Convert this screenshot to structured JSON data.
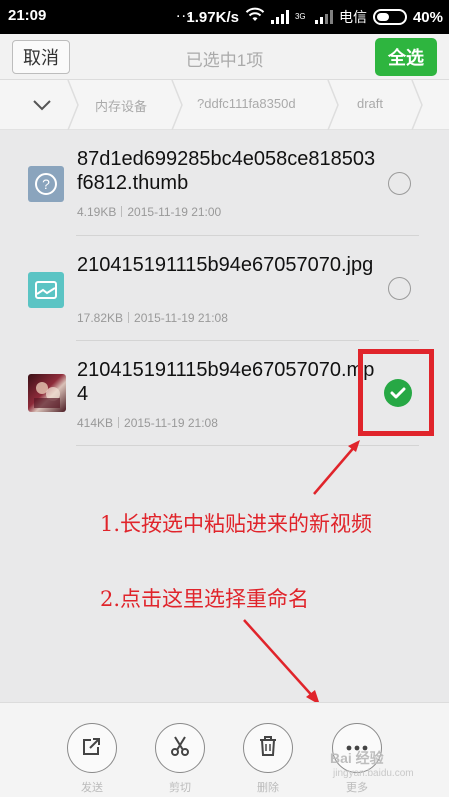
{
  "status_bar": {
    "time": "21:09",
    "dots": "...",
    "speed": "1.97K/s",
    "network_type": "3G",
    "carrier": "电信",
    "battery": "40%"
  },
  "title_bar": {
    "cancel_label": "取消",
    "title": "已选中1项",
    "select_all_label": "全选",
    "accent_color": "#2eb53f"
  },
  "breadcrumb": {
    "items": [
      "内存设备",
      "?ddfc111fa8350d",
      "draft"
    ]
  },
  "files": [
    {
      "name": "87d1ed699285bc4e058ce818503f6812.thumb",
      "size": "4.19KB",
      "date": "2015-11-19 21:00",
      "icon": "unknown-file-icon",
      "icon_color": "#8aa4bd",
      "selected": false
    },
    {
      "name": "210415191115b94e67057070.jpg",
      "size": "17.82KB",
      "date": "2015-11-19 21:08",
      "icon": "image-file-icon",
      "icon_color": "#5bc4c4",
      "selected": false
    },
    {
      "name": "210415191115b94e67057070.mp4",
      "size": "414KB",
      "date": "2015-11-19 21:08",
      "icon": "video-thumbnail",
      "icon_color": "#6a1f2a",
      "selected": true
    }
  ],
  "annotations": {
    "step1": "1.长按选中粘贴进来的新视频",
    "step2": "2.点击这里选择重命名",
    "color": "#e0242b"
  },
  "toolbar": {
    "items": [
      {
        "label": "发送",
        "icon": "share-icon"
      },
      {
        "label": "剪切",
        "icon": "scissors-icon"
      },
      {
        "label": "删除",
        "icon": "trash-icon"
      },
      {
        "label": "更多",
        "icon": "more-icon"
      }
    ]
  },
  "watermark": {
    "brand": "Bai 经验",
    "url": "jingyan.baidu.com"
  }
}
